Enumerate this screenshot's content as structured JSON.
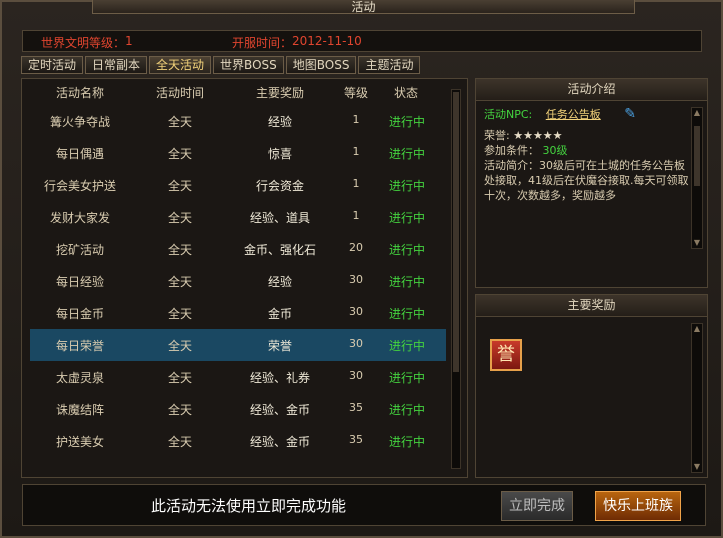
{
  "window": {
    "title": "活动"
  },
  "info": {
    "civ_label": "世界文明等级：",
    "civ_value": "1",
    "open_label": "开服时间：",
    "open_value": "2012-11-10"
  },
  "tabs": [
    "定时活动",
    "日常副本",
    "全天活动",
    "世界BOSS",
    "地图BOSS",
    "主题活动"
  ],
  "active_tab": "全天活动",
  "list": {
    "headers": [
      "活动名称",
      "活动时间",
      "主要奖励",
      "等级",
      "状态"
    ],
    "rows": [
      {
        "name": "篝火争夺战",
        "time": "全天",
        "reward": "经验",
        "level": "1",
        "status": "进行中"
      },
      {
        "name": "每日偶遇",
        "time": "全天",
        "reward": "惊喜",
        "level": "1",
        "status": "进行中"
      },
      {
        "name": "行会美女护送",
        "time": "全天",
        "reward": "行会资金",
        "level": "1",
        "status": "进行中"
      },
      {
        "name": "发财大家发",
        "time": "全天",
        "reward": "经验、道具",
        "level": "1",
        "status": "进行中"
      },
      {
        "name": "挖矿活动",
        "time": "全天",
        "reward": "金币、强化石",
        "level": "20",
        "status": "进行中"
      },
      {
        "name": "每日经验",
        "time": "全天",
        "reward": "经验",
        "level": "30",
        "status": "进行中"
      },
      {
        "name": "每日金币",
        "time": "全天",
        "reward": "金币",
        "level": "30",
        "status": "进行中"
      },
      {
        "name": "每日荣誉",
        "time": "全天",
        "reward": "荣誉",
        "level": "30",
        "status": "进行中"
      },
      {
        "name": "太虚灵泉",
        "time": "全天",
        "reward": "经验、礼券",
        "level": "30",
        "status": "进行中"
      },
      {
        "name": "诛魔结阵",
        "time": "全天",
        "reward": "经验、金币",
        "level": "35",
        "status": "进行中"
      },
      {
        "name": "护送美女",
        "time": "全天",
        "reward": "经验、金币",
        "level": "35",
        "status": "进行中"
      }
    ],
    "selected_index": 7
  },
  "intro": {
    "title": "活动介绍",
    "npc_label": "活动NPC:",
    "npc_name": "任务公告板",
    "honor_label": "荣誉:",
    "stars": "★★★★★",
    "cond_label": "参加条件：",
    "cond_value": "30级",
    "description": "活动简介：30级后可在土城的任务公告板处接取，41级后在伏魔谷接取.每天可领取十次，次数越多，奖励越多"
  },
  "rewards": {
    "title": "主要奖励",
    "icon_char": "誉"
  },
  "footer": {
    "message": "此活动无法使用立即完成功能",
    "complete_label": "立即完成",
    "happy_label": "快乐上班族"
  }
}
